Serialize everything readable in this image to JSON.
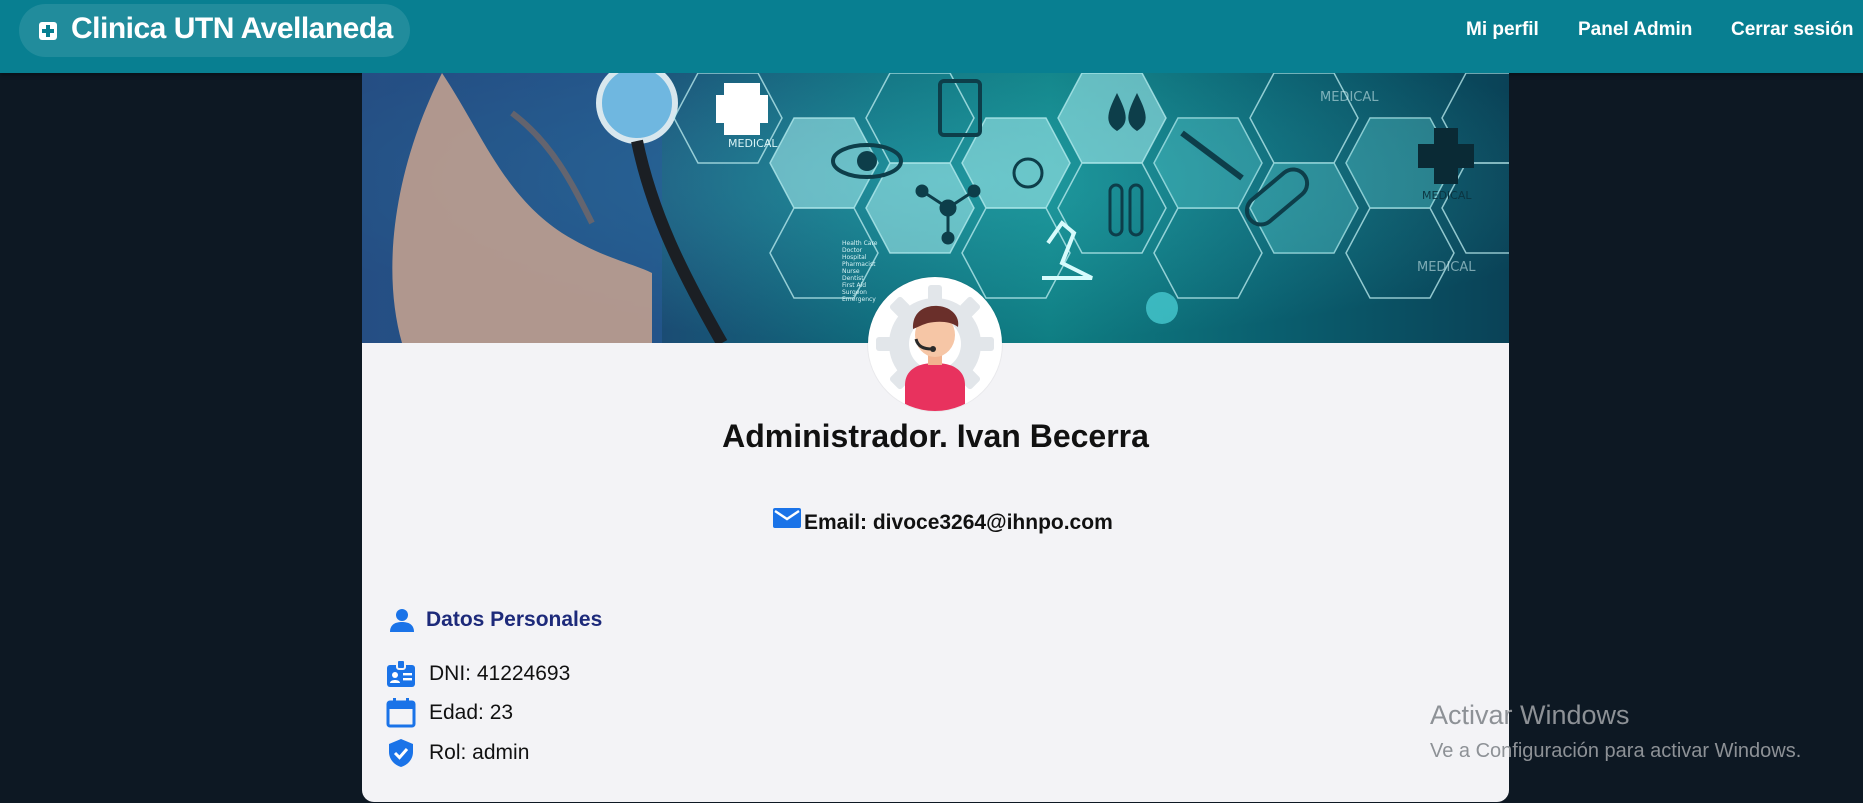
{
  "colors": {
    "navbar": "#087f91",
    "page_background": "#0d1823",
    "card_background": "#f3f3f6",
    "icon_blue": "#1a73e8",
    "section_title": "#1d2a7a"
  },
  "navbar": {
    "brand_icon": "medical-plus-icon",
    "brand": "Clinica UTN Avellaneda",
    "links": [
      "Mi perfil",
      "Panel Admin",
      "Cerrar sesión"
    ]
  },
  "banner": {
    "labels": [
      "MEDICAL",
      "MEDICAL",
      "MEDICAL",
      "MEDICAL"
    ],
    "small_text": [
      "Health Care",
      "Doctor",
      "Hospital",
      "Pharmacist",
      "Nurse",
      "Dentist",
      "First Aid",
      "Surgeon",
      "Emergency"
    ]
  },
  "profile": {
    "avatar_icon": "admin-avatar-icon",
    "name": "Administrador. Ivan Becerra",
    "email_icon": "mail-icon",
    "email": "Email: divoce3264@ihnpo.com"
  },
  "personal": {
    "title_icon": "person-icon",
    "title": "Datos Personales",
    "dni_icon": "id-badge-icon",
    "dni": "DNI: 41224693",
    "age_icon": "calendar-icon",
    "age": "Edad: 23",
    "role_icon": "shield-check-icon",
    "role": "Rol: admin"
  },
  "watermark": {
    "title": "Activar Windows",
    "subtitle": "Ve a Configuración para activar Windows."
  }
}
